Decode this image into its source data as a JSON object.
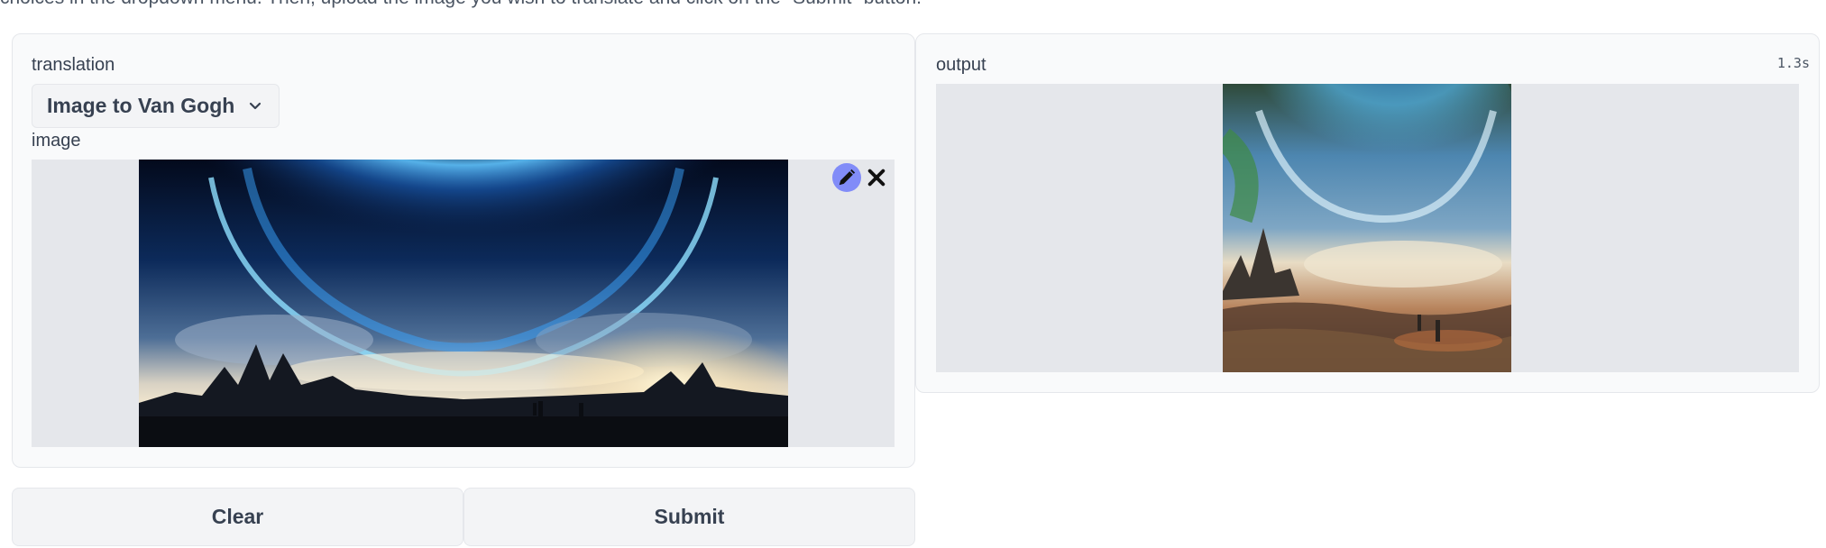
{
  "intro_text": "choices in the dropdown menu. Then, upload the image you wish to translate and click on the \"Submit\" button.",
  "inputs": {
    "translation_label": "translation",
    "translation_selected": "Image to Van Gogh",
    "image_label": "image"
  },
  "actions": {
    "clear_label": "Clear",
    "submit_label": "Submit"
  },
  "output": {
    "label": "output",
    "elapsed": "1.3s"
  },
  "colors": {
    "accent": "#818cf8",
    "panel_bg": "#f9fafb",
    "image_bg": "#e5e7eb"
  },
  "icons": {
    "edit": "pencil-icon",
    "remove": "close-icon",
    "dropdown": "chevron-down-icon"
  }
}
